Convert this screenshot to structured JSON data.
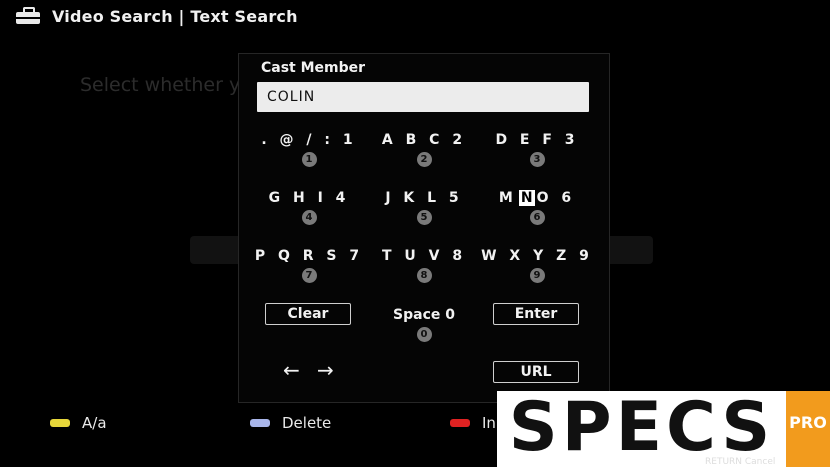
{
  "header": {
    "title": "Video Search | Text Search",
    "icon": "toolbox-icon"
  },
  "background": {
    "instruction_text": "Select whether y                                   ast Member and"
  },
  "dialog": {
    "label": "Cast Member",
    "input_value": "COLIN",
    "keys": [
      {
        "letters": ". @ / : 1",
        "digit": "1"
      },
      {
        "letters": "A B C 2",
        "digit": "2"
      },
      {
        "letters": "D E F 3",
        "digit": "3"
      },
      {
        "letters": "G H I 4",
        "digit": "4"
      },
      {
        "letters": "J K L 5",
        "digit": "5"
      },
      {
        "letters_before": "M",
        "letters_highlight": "N",
        "letters_after": "O 6",
        "digit": "6"
      },
      {
        "letters": "P Q R S 7",
        "digit": "7"
      },
      {
        "letters": "T U V 8",
        "digit": "8"
      },
      {
        "letters": "W X Y Z 9",
        "digit": "9"
      }
    ],
    "clear_label": "Clear",
    "space_label": "Space 0",
    "space_digit": "0",
    "enter_label": "Enter",
    "left_arrow": "←",
    "right_arrow": "→",
    "url_label": "URL"
  },
  "legend": [
    {
      "label": "A/a",
      "color": "#e6d63a"
    },
    {
      "label": "Delete",
      "color": "#a9b6ea"
    },
    {
      "label": "In",
      "color": "#e02222"
    }
  ],
  "watermark": {
    "main": "SPECS",
    "pro": "PRO",
    "strip": "RETURN Cancel"
  },
  "colors": {
    "background": "#000000",
    "dialog_bg": "#050505",
    "input_bg": "#ececec",
    "accent_orange": "#f29b1d"
  }
}
